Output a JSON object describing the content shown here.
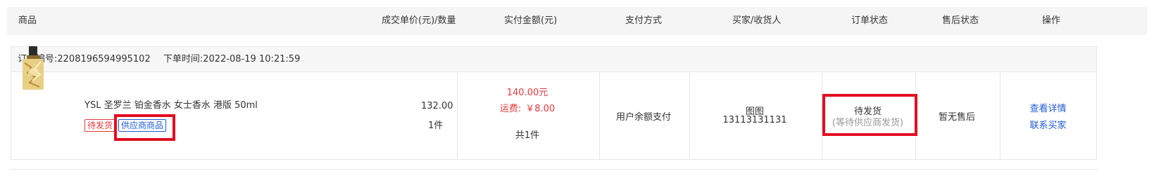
{
  "columns": {
    "product": "商品",
    "unit_price_qty": "成交单价(元)/数量",
    "amount_paid": "实付金额(元)",
    "payment_method": "支付方式",
    "buyer_receiver": "买家/收货人",
    "order_status": "订单状态",
    "after_sale_status": "售后状态",
    "actions": "操作"
  },
  "order": {
    "order_no_label": "订单编号:",
    "order_no": "2208196594995102",
    "order_time_label": "下单时间:",
    "order_time": "2022-08-19 10:21:59",
    "product_name": "YSL 圣罗兰 铂金香水 女士香水 港版 50ml",
    "tag_status": "待发货",
    "tag_supplier": "供应商商品",
    "unit_price": "132.00",
    "quantity": "1件",
    "paid_amount": "140.00元",
    "shipping_label": "运费:",
    "shipping_fee": "￥8.00",
    "total_count": "共1件",
    "payment_method": "用户余额支付",
    "buyer_name": "图图",
    "buyer_phone": "13113131131",
    "status": "待发货",
    "status_sub": "(等待供应商发货)",
    "after_sale": "暂无售后",
    "action_view": "查看详情",
    "action_contact": "联系买家"
  },
  "colors": {
    "highlight": "#e30d21",
    "price_red": "#e4393c",
    "link_blue": "#1e5bd6",
    "header_bg": "#f5f5f5"
  }
}
